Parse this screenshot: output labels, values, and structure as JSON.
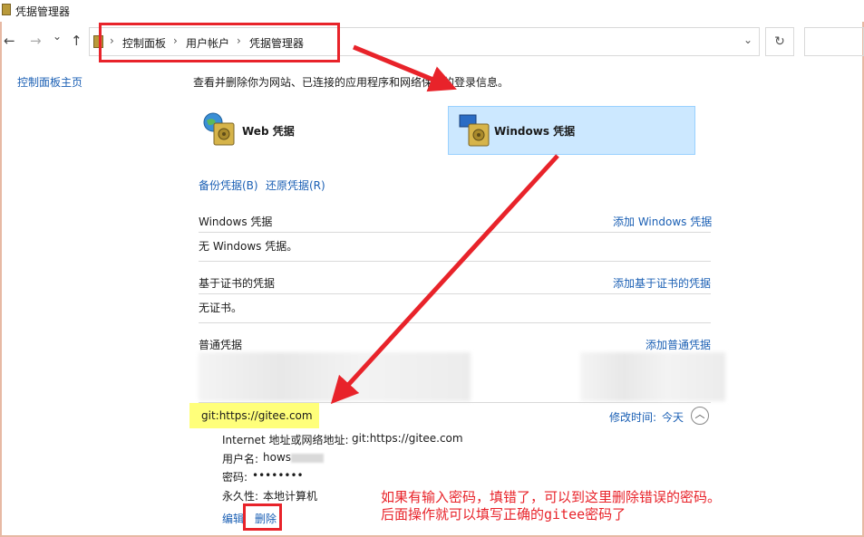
{
  "window": {
    "title": "凭据管理器"
  },
  "nav": {
    "back": "←",
    "forward": "→",
    "dropdown": "⌄",
    "up": "↑",
    "refresh": "↻"
  },
  "breadcrumb": [
    "控制面板",
    "用户帐户",
    "凭据管理器"
  ],
  "sidebar": {
    "home_link": "控制面板主页"
  },
  "main": {
    "description": "查看并删除你为网站、已连接的应用程序和网络保存的登录信息。",
    "cred_types": [
      {
        "label": "Web 凭据"
      },
      {
        "label": "Windows 凭据"
      }
    ],
    "backup_link": "备份凭据(B)",
    "restore_link": "还原凭据(R)",
    "windows_section": {
      "title": "Windows 凭据",
      "add": "添加 Windows 凭据",
      "empty": "无 Windows 凭据。"
    },
    "cert_section": {
      "title": "基于证书的凭据",
      "add": "添加基于证书的凭据",
      "empty": "无证书。"
    },
    "generic_section": {
      "title": "普通凭据",
      "add": "添加普通凭据"
    },
    "entry": {
      "name": "git:https://gitee.com",
      "modified_label": "修改时间:",
      "modified_value": "今天",
      "address_label": "Internet 地址或网络地址:",
      "address_value": "git:https://gitee.com",
      "username_label": "用户名:",
      "username_value": "hows",
      "password_label": "密码:",
      "password_value": "••••••••",
      "persistence_label": "永久性:",
      "persistence_value": "本地计算机",
      "edit": "编辑",
      "delete": "删除"
    }
  },
  "annotation": {
    "line1": "如果有输入密码，填错了，可以到这里删除错误的密码。",
    "line2": "后面操作就可以填写正确的gitee密码了"
  },
  "colors": {
    "annotation": "#e8232a",
    "highlight": "#ffff7a",
    "link": "#1a5fb4",
    "selected": "#cce8ff"
  }
}
